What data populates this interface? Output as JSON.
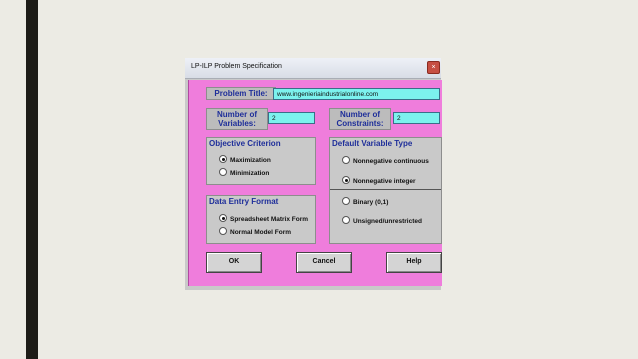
{
  "window": {
    "title": "LP-ILP Problem Specification",
    "close_symbol": "×"
  },
  "problem_title": {
    "label": "Problem Title:",
    "value": "www.ingenieriaindustrialonline.com"
  },
  "num_variables": {
    "label_line1": "Number of",
    "label_line2": "Variables:",
    "value": "2"
  },
  "num_constraints": {
    "label_line1": "Number of",
    "label_line2": "Constraints:",
    "value": "2"
  },
  "objective": {
    "title": "Objective Criterion",
    "options": [
      {
        "label": "Maximization",
        "selected": true
      },
      {
        "label": "Minimization",
        "selected": false
      }
    ]
  },
  "variable_type": {
    "title": "Default Variable Type",
    "options": [
      {
        "label": "Nonnegative continuous",
        "selected": false
      },
      {
        "label": "Nonnegative integer",
        "selected": true
      },
      {
        "label": "Binary (0,1)",
        "selected": false
      },
      {
        "label": "Unsigned/unrestricted",
        "selected": false
      }
    ]
  },
  "data_entry": {
    "title": "Data Entry Format",
    "options": [
      {
        "label": "Spreadsheet Matrix Form",
        "selected": true
      },
      {
        "label": "Normal Model Form",
        "selected": false
      }
    ]
  },
  "buttons": {
    "ok": "OK",
    "cancel": "Cancel",
    "help": "Help"
  }
}
